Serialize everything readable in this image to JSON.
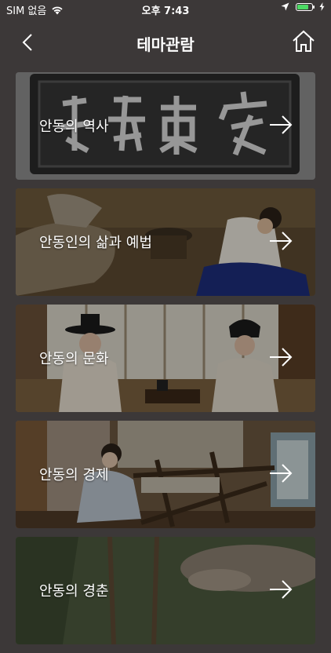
{
  "status_bar": {
    "carrier": "SIM 없음",
    "time": "오후 7:43",
    "battery_level": 0.8
  },
  "nav": {
    "title": "테마관람",
    "back_icon": "chevron-left-icon",
    "home_icon": "home-icon"
  },
  "themes": [
    {
      "label": "안동의 역사",
      "scene": "signboard"
    },
    {
      "label": "안동인의 삶과 예법",
      "scene": "ritual"
    },
    {
      "label": "안동의 문화",
      "scene": "scholars"
    },
    {
      "label": "안동의 경제",
      "scene": "loom"
    },
    {
      "label": "안동의 경춘",
      "scene": "forest"
    }
  ],
  "colors": {
    "background": "#3c3838",
    "text": "#ffffff",
    "battery": "#4cd964"
  }
}
